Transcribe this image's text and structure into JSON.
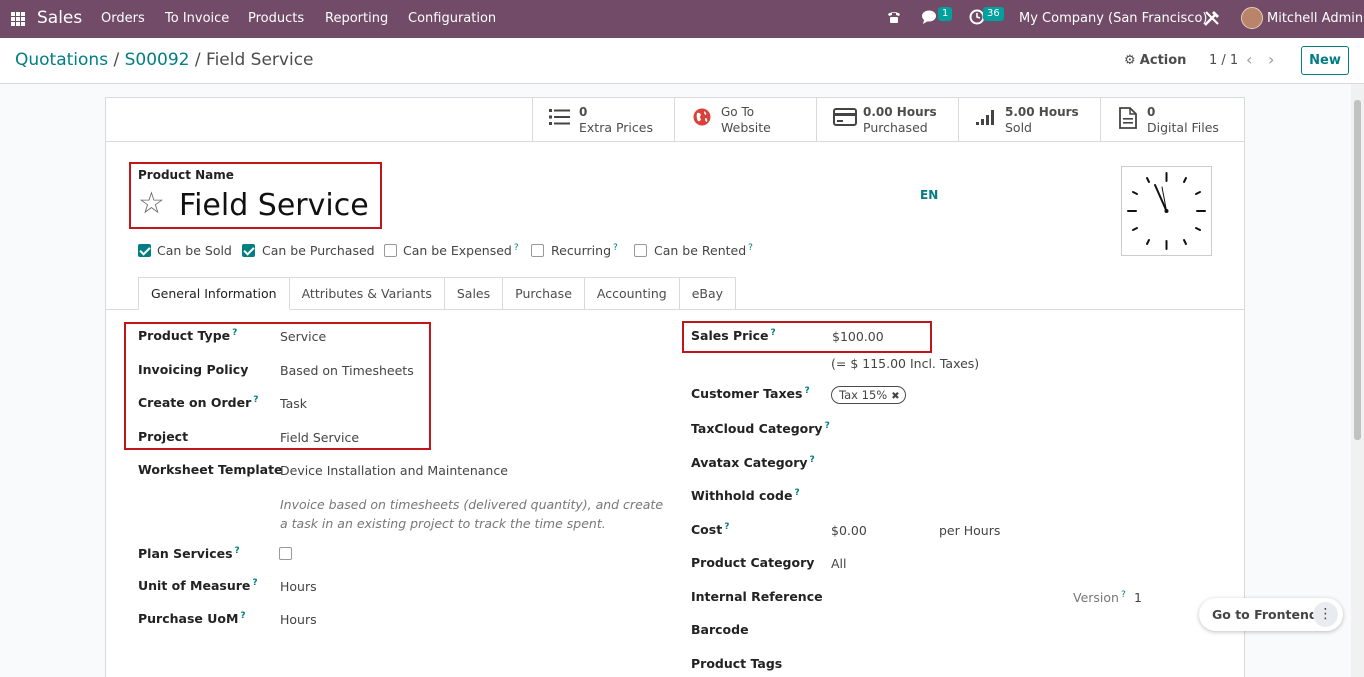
{
  "nav": {
    "app_name": "Sales",
    "menu": [
      "Orders",
      "To Invoice",
      "Products",
      "Reporting",
      "Configuration"
    ],
    "messages_count": "1",
    "activities_count": "36",
    "company": "My Company (San Francisco)",
    "user": "Mitchell Admin"
  },
  "control_panel": {
    "breadcrumb": [
      "Quotations",
      "S00092",
      "Field Service"
    ],
    "separator": "/",
    "action_label": "Action",
    "pager": "1 / 1",
    "new_label": "New"
  },
  "smart_buttons": [
    {
      "icon": "list-icon",
      "value": "0",
      "label": "Extra Prices"
    },
    {
      "icon": "globe-icon",
      "value": "Go To",
      "label": "Website"
    },
    {
      "icon": "credit-card-icon",
      "value": "0.00 Hours",
      "label": "Purchased"
    },
    {
      "icon": "signal-icon",
      "value": "5.00 Hours",
      "label": "Sold"
    },
    {
      "icon": "file-icon",
      "value": "0",
      "label": "Digital Files"
    }
  ],
  "product": {
    "name_label": "Product Name",
    "name": "Field Service",
    "lang": "EN"
  },
  "options": [
    {
      "label": "Can be Sold",
      "checked": true,
      "help": ""
    },
    {
      "label": "Can be Purchased",
      "checked": true,
      "help": ""
    },
    {
      "label": "Can be Expensed",
      "checked": false,
      "help": "?"
    },
    {
      "label": "Recurring",
      "checked": false,
      "help": "?"
    },
    {
      "label": "Can be Rented",
      "checked": false,
      "help": "?"
    }
  ],
  "tabs": [
    "General Information",
    "Attributes & Variants",
    "Sales",
    "Purchase",
    "Accounting",
    "eBay"
  ],
  "left_fields": {
    "product_type": {
      "label": "Product Type",
      "value": "Service"
    },
    "invoicing_policy": {
      "label": "Invoicing Policy",
      "value": "Based on Timesheets"
    },
    "create_on_order": {
      "label": "Create on Order",
      "value": "Task"
    },
    "project": {
      "label": "Project",
      "value": "Field Service"
    },
    "worksheet_template": {
      "label": "Worksheet Template",
      "value": "Device Installation and Maintenance"
    },
    "note": "Invoice based on timesheets (delivered quantity), and create a task in an existing project to track the time spent.",
    "plan_services": {
      "label": "Plan Services",
      "checked": false
    },
    "uom": {
      "label": "Unit of Measure",
      "value": "Hours"
    },
    "purchase_uom": {
      "label": "Purchase UoM",
      "value": "Hours"
    }
  },
  "right_fields": {
    "sales_price": {
      "label": "Sales Price",
      "value": "$100.00"
    },
    "incl_taxes": "(= $ 115.00 Incl. Taxes)",
    "customer_taxes": {
      "label": "Customer Taxes",
      "tag": "Tax 15%"
    },
    "taxcloud": {
      "label": "TaxCloud Category"
    },
    "avatax": {
      "label": "Avatax Category"
    },
    "withhold": {
      "label": "Withhold code"
    },
    "cost": {
      "label": "Cost",
      "value": "$0.00",
      "unit": "per Hours"
    },
    "category": {
      "label": "Product Category",
      "value": "All"
    },
    "internal_ref": {
      "label": "Internal Reference"
    },
    "version": {
      "label": "Version",
      "value": "1"
    },
    "barcode": {
      "label": "Barcode"
    },
    "tags": {
      "label": "Product Tags"
    }
  },
  "help_mark": "?",
  "frontend_button": "Go to Frontend",
  "colors": {
    "brand": "#714b67",
    "accent": "#017e84",
    "highlight": "#c0151b"
  }
}
